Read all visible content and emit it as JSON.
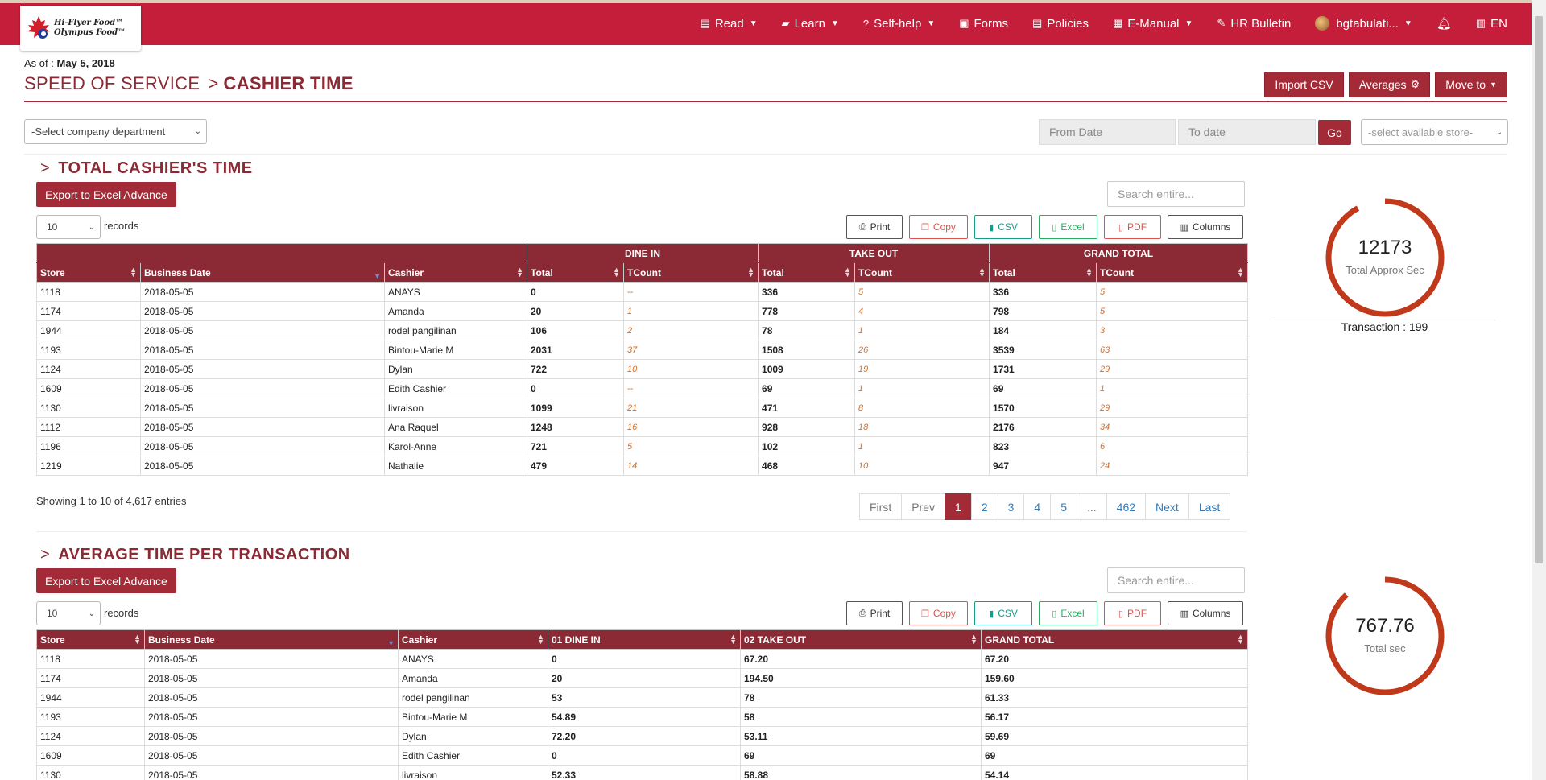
{
  "brand": {
    "line1": "Hi-Flyer Food™",
    "line2": "Olympus Food™"
  },
  "nav": {
    "read": "Read",
    "learn": "Learn",
    "selfhelp": "Self-help",
    "forms": "Forms",
    "policies": "Policies",
    "emanual": "E-Manual",
    "hrbulletin": "HR Bulletin",
    "user": "bgtabulati...",
    "lang": "EN"
  },
  "header": {
    "asof_label": "As of :",
    "asof_date": "May 5, 2018",
    "title_main": "SPEED OF SERVICE",
    "title_sub": "CASHIER TIME",
    "btn_import": "Import CSV",
    "btn_averages": "Averages",
    "btn_move": "Move to"
  },
  "filters": {
    "department": "-Select company department",
    "from_placeholder": "From Date",
    "to_placeholder": "To date",
    "go": "Go",
    "store": "-select available store-"
  },
  "common": {
    "export": "Export to Excel Advance",
    "search_placeholder": "Search entire...",
    "page_len": "10",
    "records": "records",
    "print": "Print",
    "copy": "Copy",
    "csv": "CSV",
    "excel": "Excel",
    "pdf": "PDF",
    "columns": "Columns"
  },
  "section1": {
    "title": "TOTAL CASHIER'S TIME",
    "groups": [
      "DINE IN",
      "TAKE OUT",
      "GRAND TOTAL"
    ],
    "headers": [
      "Store",
      "Business Date",
      "Cashier",
      "Total",
      "TCount",
      "Total",
      "TCount",
      "Total",
      "TCount"
    ],
    "rows": [
      [
        "1118",
        "2018-05-05",
        "ANAYS",
        "0",
        "--",
        "336",
        "5",
        "336",
        "5"
      ],
      [
        "1174",
        "2018-05-05",
        "Amanda",
        "20",
        "1",
        "778",
        "4",
        "798",
        "5"
      ],
      [
        "1944",
        "2018-05-05",
        "rodel pangilinan",
        "106",
        "2",
        "78",
        "1",
        "184",
        "3"
      ],
      [
        "1193",
        "2018-05-05",
        "Bintou-Marie M",
        "2031",
        "37",
        "1508",
        "26",
        "3539",
        "63"
      ],
      [
        "1124",
        "2018-05-05",
        "Dylan",
        "722",
        "10",
        "1009",
        "19",
        "1731",
        "29"
      ],
      [
        "1609",
        "2018-05-05",
        "Edith Cashier",
        "0",
        "--",
        "69",
        "1",
        "69",
        "1"
      ],
      [
        "1130",
        "2018-05-05",
        "livraison",
        "1099",
        "21",
        "471",
        "8",
        "1570",
        "29"
      ],
      [
        "1112",
        "2018-05-05",
        "Ana Raquel",
        "1248",
        "16",
        "928",
        "18",
        "2176",
        "34"
      ],
      [
        "1196",
        "2018-05-05",
        "Karol-Anne",
        "721",
        "5",
        "102",
        "1",
        "823",
        "6"
      ],
      [
        "1219",
        "2018-05-05",
        "Nathalie",
        "479",
        "14",
        "468",
        "10",
        "947",
        "24"
      ]
    ],
    "showing": "Showing 1 to 10 of 4,617 entries",
    "pager": [
      "First",
      "Prev",
      "1",
      "2",
      "3",
      "4",
      "5",
      "...",
      "462",
      "Next",
      "Last"
    ],
    "gauge_value": "12173",
    "gauge_label": "Total Approx Sec",
    "gauge_fill": 0.92,
    "transaction": "Transaction : 199"
  },
  "section2": {
    "title": "AVERAGE TIME PER TRANSACTION",
    "headers": [
      "Store",
      "Business Date",
      "Cashier",
      "01 DINE IN",
      "02 TAKE OUT",
      "GRAND TOTAL"
    ],
    "rows": [
      [
        "1118",
        "2018-05-05",
        "ANAYS",
        "0",
        "67.20",
        "67.20"
      ],
      [
        "1174",
        "2018-05-05",
        "Amanda",
        "20",
        "194.50",
        "159.60"
      ],
      [
        "1944",
        "2018-05-05",
        "rodel pangilinan",
        "53",
        "78",
        "61.33"
      ],
      [
        "1193",
        "2018-05-05",
        "Bintou-Marie M",
        "54.89",
        "58",
        "56.17"
      ],
      [
        "1124",
        "2018-05-05",
        "Dylan",
        "72.20",
        "53.11",
        "59.69"
      ],
      [
        "1609",
        "2018-05-05",
        "Edith Cashier",
        "0",
        "69",
        "69"
      ],
      [
        "1130",
        "2018-05-05",
        "livraison",
        "52.33",
        "58.88",
        "54.14"
      ]
    ],
    "gauge_value": "767.76",
    "gauge_label": "Total sec",
    "gauge_fill": 0.88
  },
  "colors": {
    "brand_red": "#c41e3a",
    "dark_red": "#8b2a35",
    "button_red": "#a32b38",
    "gauge": "#c0391b",
    "tcount_orange": "#e06a1b"
  }
}
